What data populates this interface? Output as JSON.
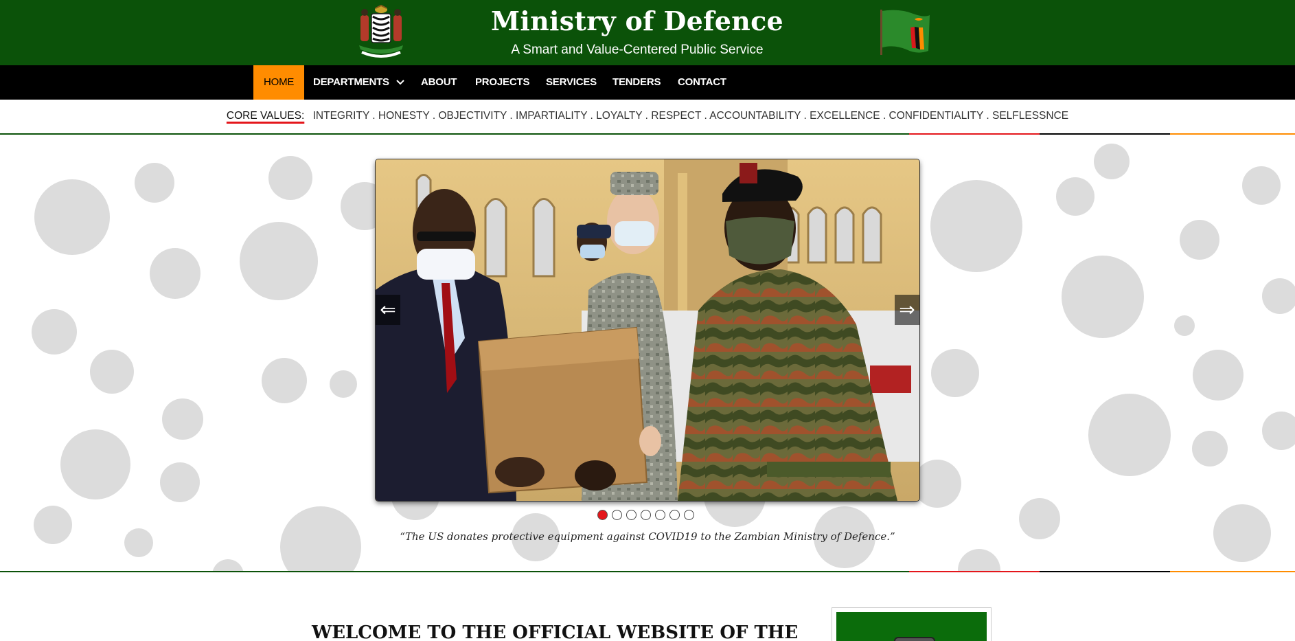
{
  "header": {
    "title": "Ministry of Defence",
    "subtitle": "A Smart and Value-Centered Public Service",
    "coat_of_arms_icon": "zambia-coat-of-arms",
    "flag_icon": "zambia-flag",
    "background_color": "#0b5209"
  },
  "nav": {
    "items": [
      {
        "label": "HOME",
        "active": true
      },
      {
        "label": "DEPARTMENTS",
        "has_dropdown": true
      },
      {
        "label": "ABOUT"
      },
      {
        "label": "PROJECTS"
      },
      {
        "label": "SERVICES"
      },
      {
        "label": "TENDERS"
      },
      {
        "label": "CONTACT"
      }
    ],
    "active_color": "#ff8c00"
  },
  "core_values": {
    "label": "CORE VALUES:",
    "text": "INTEGRITY . HONESTY . OBJECTIVITY . IMPARTIALITY . LOYALTY . RESPECT . ACCOUNTABILITY . EXCELLENCE . CONFIDENTIALITY . SELFLESSNCE"
  },
  "carousel": {
    "prev_label": "⇐",
    "next_label": "⇒",
    "slide_count": 7,
    "active_index": 0,
    "caption": "“The US donates protective equipment against COVID19 to the Zambian Ministry of Defence.”"
  },
  "welcome": {
    "heading": "WELCOME TO THE OFFICIAL WEBSITE OF THE"
  },
  "colors": {
    "green": "#0b5209",
    "red": "#e4161b",
    "black": "#000000",
    "orange": "#ff8c00"
  }
}
